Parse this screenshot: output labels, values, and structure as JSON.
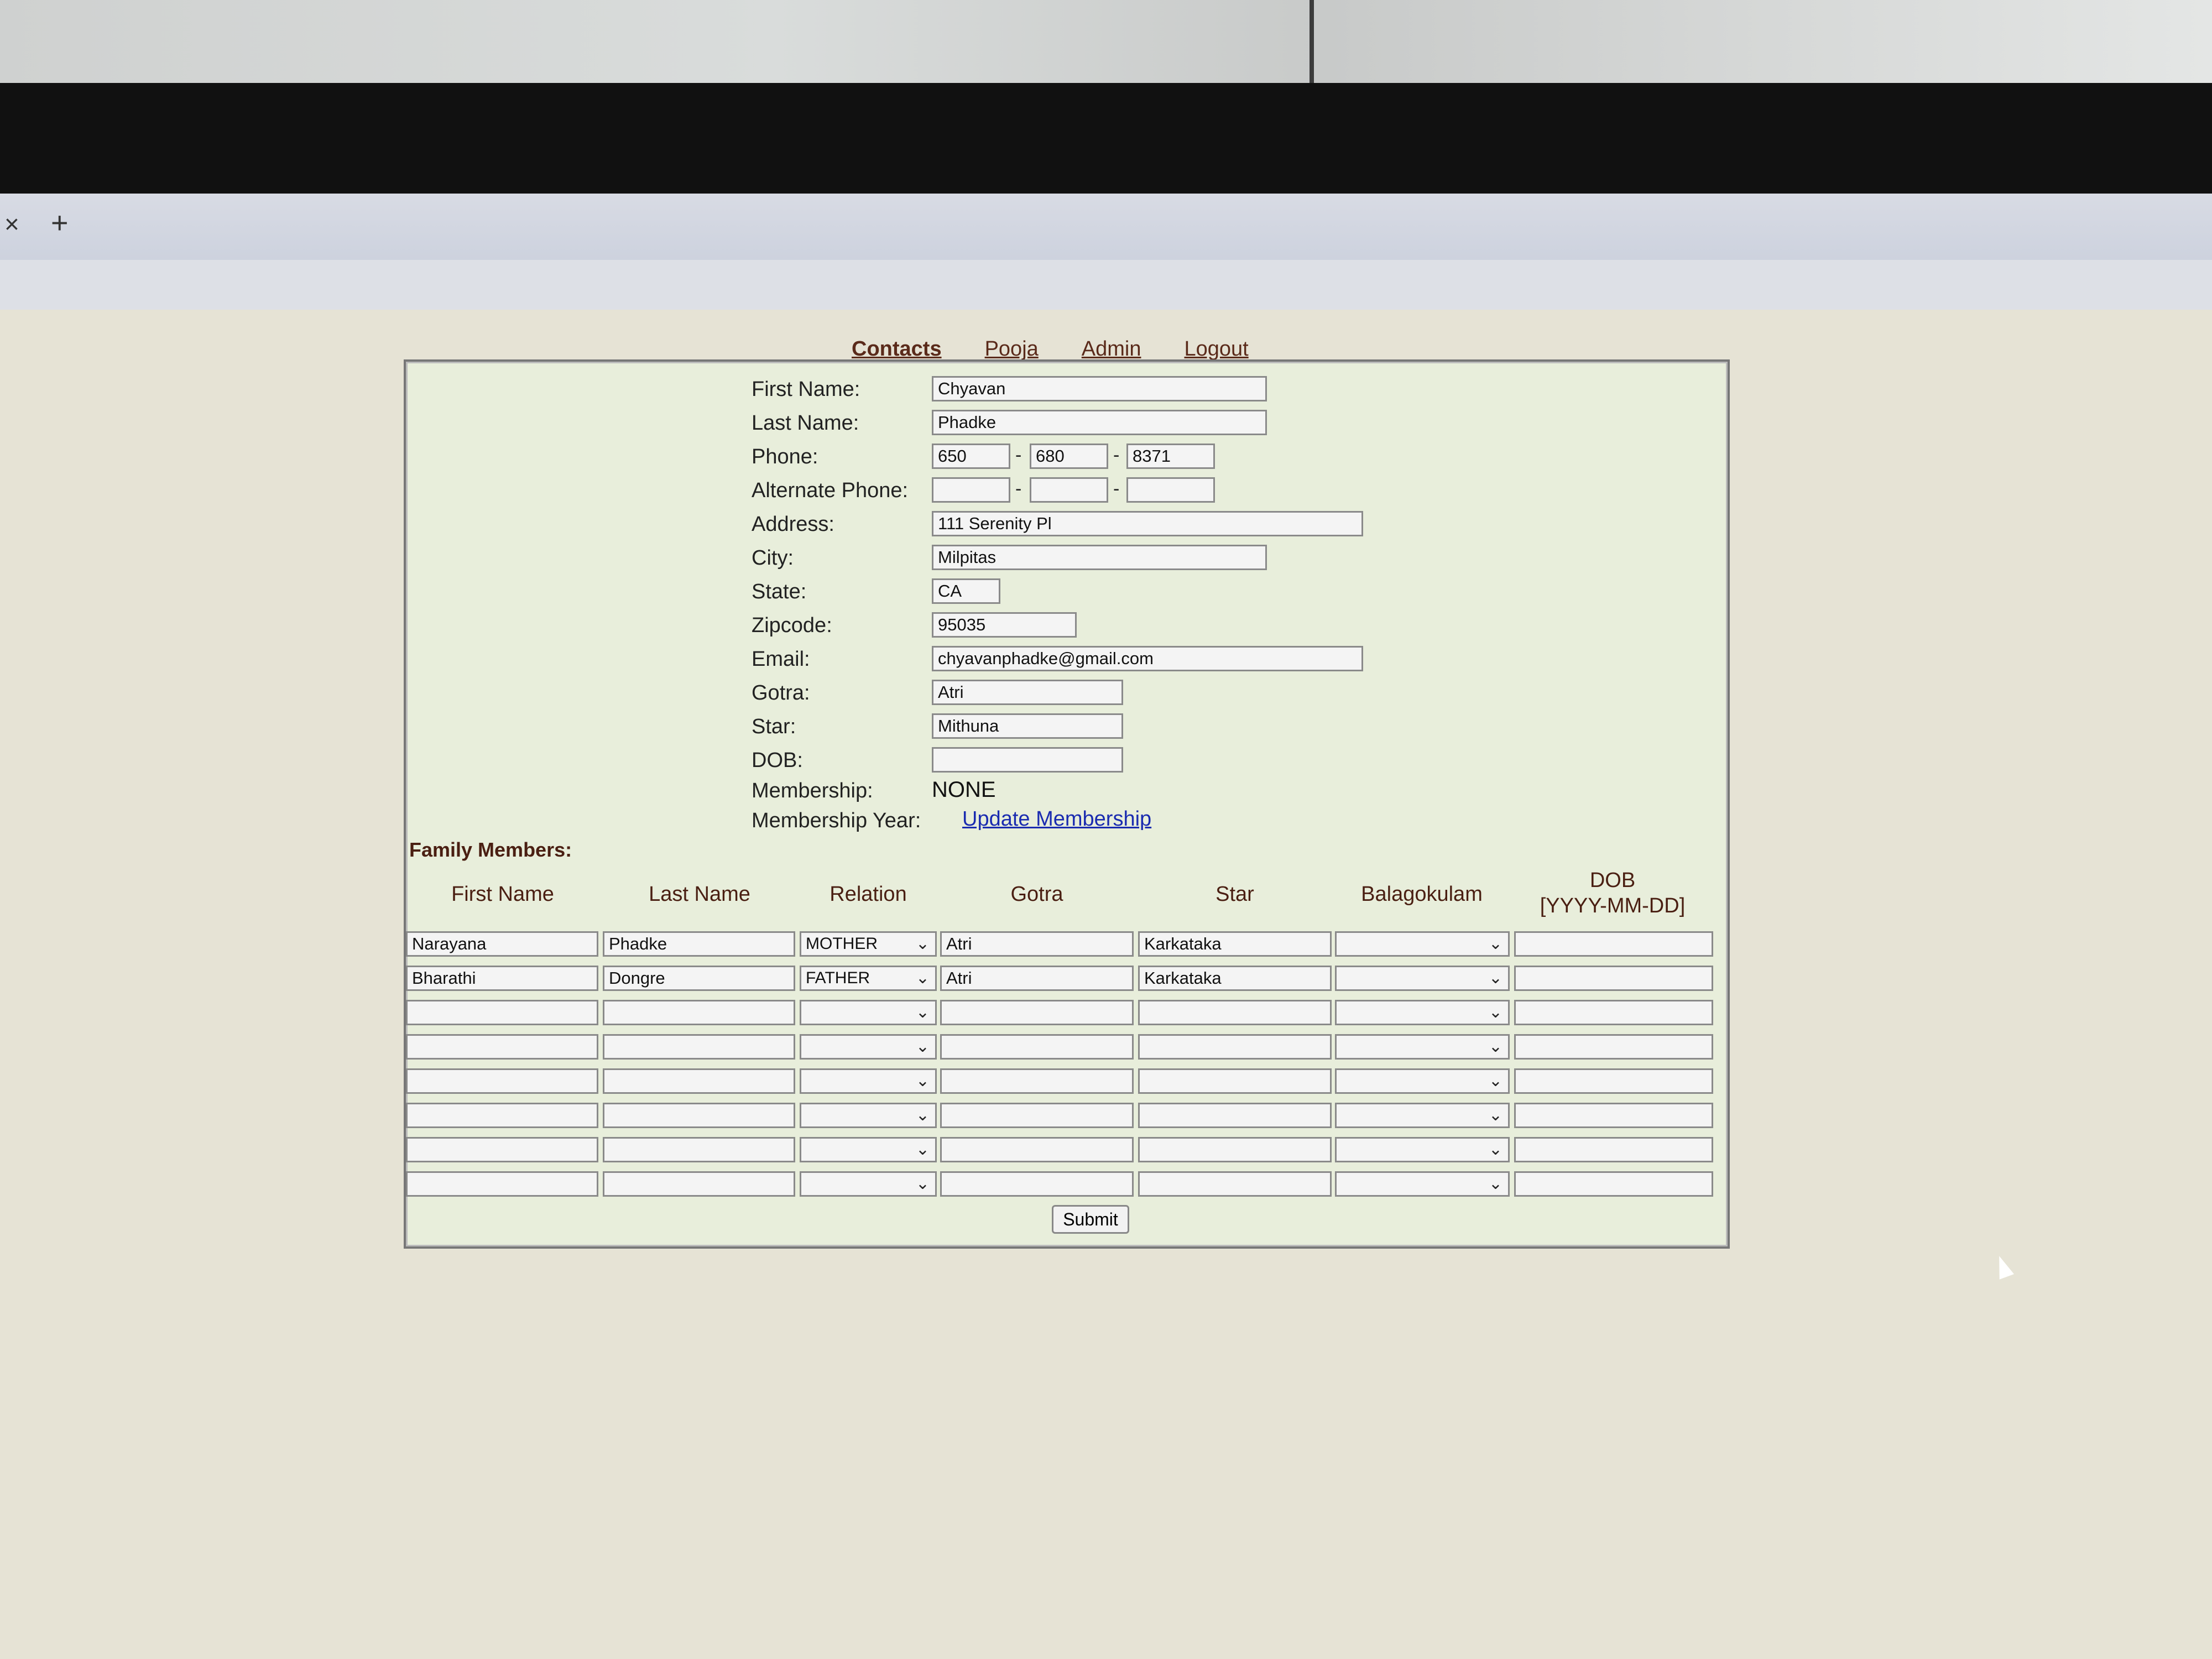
{
  "browser": {
    "tab_close": "×",
    "tab_add": "+"
  },
  "nav": {
    "contacts": "Contacts",
    "pooja": "Pooja",
    "admin": "Admin",
    "logout": "Logout"
  },
  "form": {
    "labels": {
      "first_name": "First Name:",
      "last_name": "Last Name:",
      "phone": "Phone:",
      "alt_phone": "Alternate Phone:",
      "address": "Address:",
      "city": "City:",
      "state": "State:",
      "zipcode": "Zipcode:",
      "email": "Email:",
      "gotra": "Gotra:",
      "star": "Star:",
      "dob": "DOB:",
      "membership": "Membership:",
      "membership_year": "Membership Year:"
    },
    "values": {
      "first_name": "Chyavan",
      "last_name": "Phadke",
      "phone1": "650",
      "phone2": "680",
      "phone3": "8371",
      "alt1": "",
      "alt2": "",
      "alt3": "",
      "address": "111 Serenity Pl",
      "city": "Milpitas",
      "state": "CA",
      "zipcode": "95035",
      "email": "chyavanphadke@gmail.com",
      "gotra": "Atri",
      "star": "Mithuna",
      "dob": "",
      "membership": "NONE"
    },
    "dash": "-",
    "update_membership": "Update Membership"
  },
  "family": {
    "title": "Family Members:",
    "headers": [
      "First Name",
      "Last Name",
      "Relation",
      "Gotra",
      "Star",
      "Balagokulam",
      "DOB",
      "[YYYY-MM-DD]"
    ],
    "rows": [
      {
        "first": "Narayana",
        "last": "Phadke",
        "relation": "MOTHER",
        "gotra": "Atri",
        "star": "Karkataka",
        "bala": "",
        "dob": ""
      },
      {
        "first": "Bharathi",
        "last": "Dongre",
        "relation": "FATHER",
        "gotra": "Atri",
        "star": "Karkataka",
        "bala": "",
        "dob": ""
      },
      {
        "first": "",
        "last": "",
        "relation": "",
        "gotra": "",
        "star": "",
        "bala": "",
        "dob": ""
      },
      {
        "first": "",
        "last": "",
        "relation": "",
        "gotra": "",
        "star": "",
        "bala": "",
        "dob": ""
      },
      {
        "first": "",
        "last": "",
        "relation": "",
        "gotra": "",
        "star": "",
        "bala": "",
        "dob": ""
      },
      {
        "first": "",
        "last": "",
        "relation": "",
        "gotra": "",
        "star": "",
        "bala": "",
        "dob": ""
      },
      {
        "first": "",
        "last": "",
        "relation": "",
        "gotra": "",
        "star": "",
        "bala": "",
        "dob": ""
      },
      {
        "first": "",
        "last": "",
        "relation": "",
        "gotra": "",
        "star": "",
        "bala": "",
        "dob": ""
      }
    ],
    "submit": "Submit"
  }
}
